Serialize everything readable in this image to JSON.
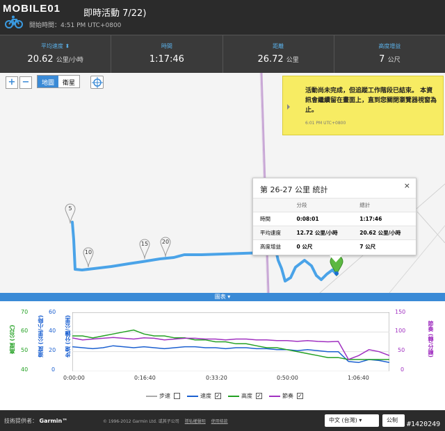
{
  "header": {
    "logo": "MOBILE01",
    "title": "即時活動 7/22)",
    "start_time": "開始時間：4:51 PM UTC+0800"
  },
  "stats": [
    {
      "label": "平均速度 ⬍",
      "value": "20.62",
      "unit": "公里/小時"
    },
    {
      "label": "時間",
      "value": "1:17:46",
      "unit": ""
    },
    {
      "label": "距離",
      "value": "26.72",
      "unit": "公里"
    },
    {
      "label": "高度增益",
      "value": "7",
      "unit": "公尺"
    }
  ],
  "map_controls": {
    "zoom_in": "+",
    "zoom_out": "−",
    "map": "地圖",
    "satellite": "衛星"
  },
  "notice": {
    "text": "活動尚未完成，但追蹤工作階段已結束。 本資訊會繼續留在畫面上，直到您關閉瀏覽器視窗為止。",
    "time": "6:01 PM UTC+0800"
  },
  "popup": {
    "title": "第 26-27 公里 統計",
    "close": "×",
    "columns": [
      "",
      "分段",
      "總計"
    ],
    "rows": [
      {
        "label": "時間",
        "segment": "0:08:01",
        "total": "1:17:46"
      },
      {
        "label": "平均速度",
        "segment": "12.72 公里/小時",
        "total": "20.62 公里/小時"
      },
      {
        "label": "高度增益",
        "segment": "0 公尺",
        "total": "7 公尺"
      }
    ]
  },
  "route_markers": [
    "5",
    "10",
    "15",
    "20"
  ],
  "chart_toggle": "圖表 ▾",
  "chart_data": {
    "type": "line",
    "x_ticks": [
      "0:00:00",
      "0:16:40",
      "0:33:20",
      "0:50:00",
      "1:06:40"
    ],
    "axes": {
      "elevation": {
        "label": "高度 (公尺)",
        "ticks": [
          "70",
          "60",
          "50",
          "40"
        ],
        "color": "#22a022"
      },
      "speed": {
        "label": "速度 (公里/小時)",
        "ticks": [
          "60",
          "40",
          "20",
          "0"
        ],
        "color": "#1a5fd0"
      },
      "pace": {
        "label": "步速 (分鐘/公里)",
        "ticks": [
          "",
          "",
          "",
          ""
        ],
        "color": "#1a5fd0"
      },
      "cadence": {
        "label": "節奏 (轉/分鐘)",
        "ticks": [
          "150",
          "100",
          "50",
          "0"
        ],
        "color": "#a030c0"
      }
    },
    "series": [
      {
        "name": "速度",
        "color": "#1a5fd0",
        "values": [
          25,
          24,
          23,
          24,
          26,
          25,
          24,
          25,
          24,
          23,
          24,
          25,
          25,
          24,
          24,
          23,
          24,
          24,
          23,
          23,
          22,
          22,
          21,
          22,
          21,
          20,
          20,
          10,
          9,
          12,
          11,
          9
        ]
      },
      {
        "name": "高度",
        "color": "#22a022",
        "values": [
          58,
          58,
          57,
          58,
          59,
          60,
          61,
          59,
          58,
          58,
          57,
          57,
          56,
          56,
          55,
          55,
          54,
          54,
          53,
          52,
          52,
          51,
          50,
          49,
          48,
          47,
          47,
          46,
          46,
          46,
          46,
          46
        ]
      },
      {
        "name": "節奏",
        "color": "#a030c0",
        "values": [
          85,
          80,
          82,
          84,
          86,
          84,
          82,
          85,
          84,
          80,
          82,
          84,
          84,
          82,
          82,
          80,
          82,
          82,
          80,
          80,
          78,
          78,
          76,
          78,
          76,
          75,
          76,
          30,
          40,
          55,
          50,
          40
        ]
      }
    ],
    "legend": [
      {
        "name": "步速",
        "checked": false,
        "color": "#aaaaaa"
      },
      {
        "name": "速度",
        "checked": true,
        "color": "#1a5fd0"
      },
      {
        "name": "高度",
        "checked": true,
        "color": "#22a022"
      },
      {
        "name": "節奏",
        "checked": true,
        "color": "#a030c0"
      }
    ]
  },
  "footer": {
    "provided_by": "技術提供者：",
    "brand": "Garmin™",
    "copyright": "© 1996-2012 Garmin Ltd. 或其子公司",
    "link1": "隱私權聲明",
    "link2": "使用條款",
    "language": "中文 (台灣)",
    "units": "公制"
  },
  "image_id": "#1420249"
}
